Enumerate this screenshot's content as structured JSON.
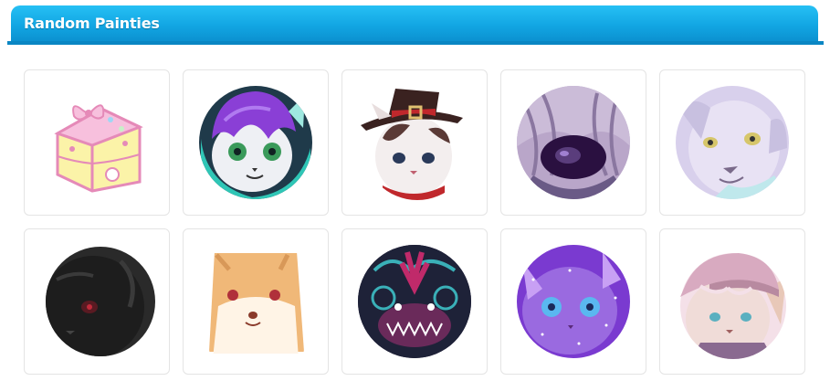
{
  "header": {
    "title": "Random Painties",
    "accent": "#12a6e3"
  },
  "painties": [
    {
      "icon": "cake-slice-with-bow-icon",
      "colors": [
        "#fbf3a8",
        "#f0a6cf",
        "#f7c0dd"
      ]
    },
    {
      "icon": "purple-haired-cat-icon",
      "colors": [
        "#8a3fd6",
        "#eef0f4",
        "#2fc6b6"
      ]
    },
    {
      "icon": "cat-with-top-hat-icon",
      "colors": [
        "#3a2220",
        "#f3eeee",
        "#c0282c"
      ]
    },
    {
      "icon": "dark-purple-creature-icon",
      "colors": [
        "#b9a6c9",
        "#5a3d7c",
        "#2a1040"
      ]
    },
    {
      "icon": "white-wolf-icon",
      "colors": [
        "#e8e2f4",
        "#c8c0e0",
        "#bfe8ec"
      ]
    },
    {
      "icon": "black-cat-icon",
      "colors": [
        "#1d1d1d",
        "#3a3a3a",
        "#8a1a2a"
      ]
    },
    {
      "icon": "shiba-dog-icon",
      "colors": [
        "#f0b878",
        "#fff4e6",
        "#c06050"
      ]
    },
    {
      "icon": "dragon-icon",
      "colors": [
        "#2a1a3a",
        "#c02a6a",
        "#3ab0b8"
      ]
    },
    {
      "icon": "galaxy-cat-icon",
      "colors": [
        "#7a3ad0",
        "#c8a0f4",
        "#5ab8f0"
      ]
    },
    {
      "icon": "creature-with-cap-icon",
      "colors": [
        "#d8aac0",
        "#f4e0e8",
        "#8a6a90"
      ]
    }
  ]
}
